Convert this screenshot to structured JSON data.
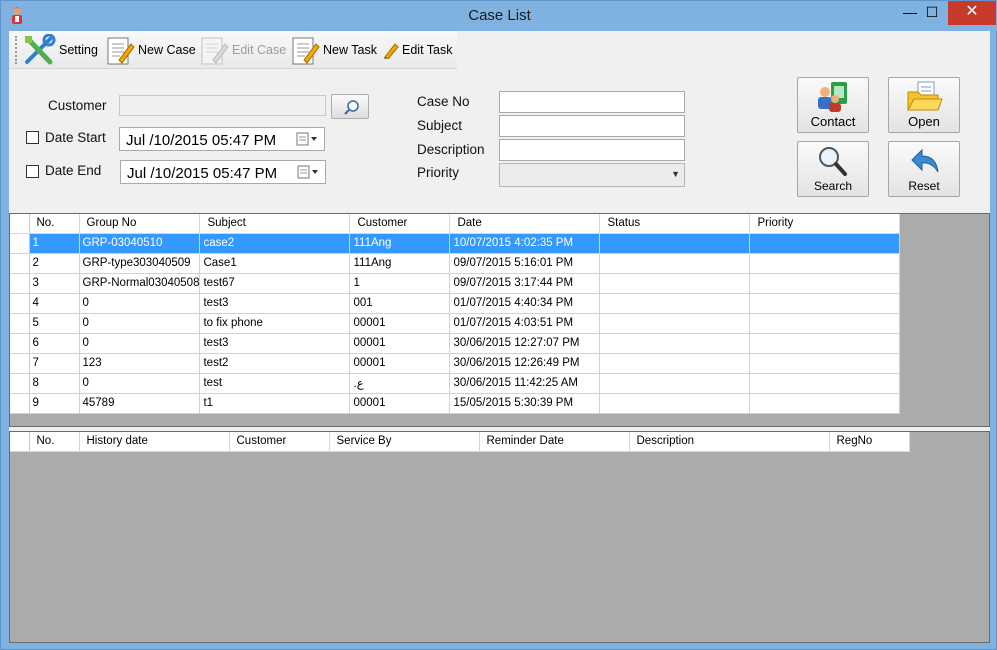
{
  "window": {
    "title": "Case List",
    "controls": {
      "minimize": "—",
      "maximize": "☐",
      "close": "✕"
    }
  },
  "toolbar": {
    "setting": "Setting",
    "new_case": "New Case",
    "edit_case": "Edit Case",
    "new_task": "New Task",
    "edit_task": "Edit Task"
  },
  "filters": {
    "customer_label": "Customer",
    "customer_value": "",
    "date_start_label": "Date Start",
    "date_start_value": "Jul /10/2015 05:47 PM",
    "date_start_checked": false,
    "date_end_label": "Date End",
    "date_end_value": "Jul /10/2015 05:47 PM",
    "date_end_checked": false,
    "case_no_label": "Case No",
    "case_no_value": "",
    "subject_label": "Subject",
    "subject_value": "",
    "description_label": "Description",
    "description_value": "",
    "priority_label": "Priority",
    "priority_value": ""
  },
  "actions": {
    "contact": "Contact",
    "open": "Open",
    "search": "Search",
    "reset": "Reset"
  },
  "cases_grid": {
    "columns": [
      "No.",
      "Group No",
      "Subject",
      "Customer",
      "Date",
      "Status",
      "Priority"
    ],
    "selected_row": 0,
    "rows": [
      [
        "1",
        "GRP-03040510",
        "case2",
        "111Ang",
        "10/07/2015 4:02:35 PM",
        "",
        ""
      ],
      [
        "2",
        "GRP-type303040509",
        "Case1",
        "111Ang",
        "09/07/2015 5:16:01 PM",
        "",
        ""
      ],
      [
        "3",
        "GRP-Normal03040508",
        "test67",
        "1",
        "09/07/2015 3:17:44 PM",
        "",
        ""
      ],
      [
        "4",
        "0",
        "test3",
        "001",
        "01/07/2015 4:40:34 PM",
        "",
        ""
      ],
      [
        "5",
        "0",
        "to fix phone",
        "00001",
        "01/07/2015 4:03:51 PM",
        "",
        ""
      ],
      [
        "6",
        "0",
        "test3",
        "00001",
        "30/06/2015 12:27:07 PM",
        "",
        ""
      ],
      [
        "7",
        "123",
        "test2",
        "00001",
        "30/06/2015 12:26:49 PM",
        "",
        ""
      ],
      [
        "8",
        "0",
        "test",
        ".ع",
        "30/06/2015 11:42:25 AM",
        "",
        ""
      ],
      [
        "9",
        "45789",
        "t1",
        "00001",
        "15/05/2015 5:30:39 PM",
        "",
        ""
      ]
    ]
  },
  "history_grid": {
    "columns": [
      "No.",
      "History date",
      "Customer",
      "Service By",
      "Reminder Date",
      "Description",
      "RegNo"
    ],
    "rows": []
  }
}
